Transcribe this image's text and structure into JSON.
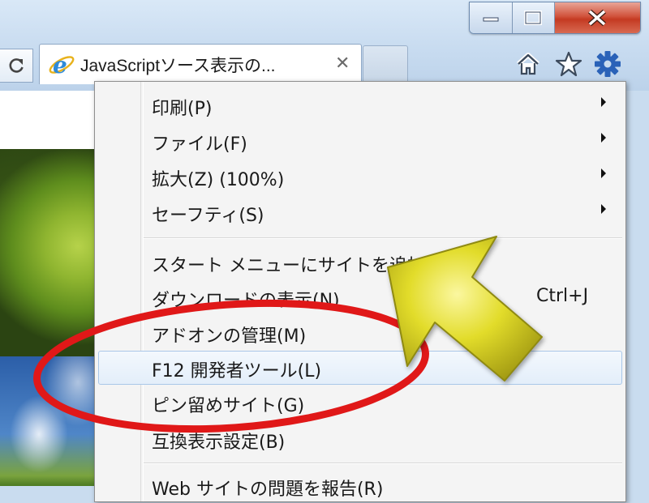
{
  "window": {
    "minimize_icon": "minimize-icon",
    "maximize_icon": "maximize-icon",
    "close_icon": "close-icon"
  },
  "tabs": {
    "active_title": "JavaScriptソース表示の...",
    "close_glyph": "✕"
  },
  "toolbar": {
    "icons": [
      "refresh-icon",
      "home-icon",
      "star-icon",
      "gear-icon"
    ]
  },
  "menu": {
    "items": [
      {
        "label": "印刷(P)",
        "submenu": true
      },
      {
        "label": "ファイル(F)",
        "submenu": true
      },
      {
        "label": "拡大(Z) (100%)",
        "submenu": true
      },
      {
        "label": "セーフティ(S)",
        "submenu": true
      },
      {
        "label": "スタート メニューにサイトを追加(M)",
        "submenu": false
      },
      {
        "label": "ダウンロードの表示(N)",
        "submenu": false,
        "shortcut": "Ctrl+J"
      },
      {
        "label": "アドオンの管理(M)",
        "submenu": false
      },
      {
        "label": "F12 開発者ツール(L)",
        "submenu": false,
        "highlighted": true
      },
      {
        "label": "ピン留めサイト(G)",
        "submenu": false
      },
      {
        "label": "互換表示設定(B)",
        "submenu": false
      },
      {
        "label": "Web サイトの問題を報告(R)",
        "submenu": false
      }
    ]
  },
  "colors": {
    "highlight_ellipse": "#e01818",
    "arrow_fill": "#d6d21a",
    "close_button": "#c9432b",
    "gear": "#2a62b8"
  }
}
